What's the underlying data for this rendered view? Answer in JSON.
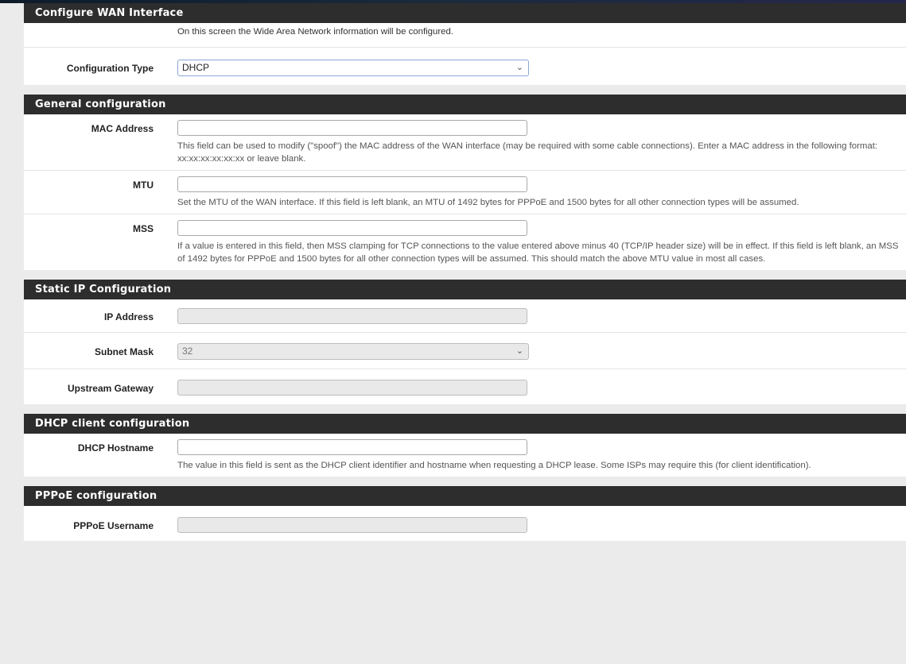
{
  "sections": {
    "wan": {
      "title": "Configure WAN Interface",
      "intro": "On this screen the Wide Area Network information will be configured.",
      "config_type_label": "Configuration Type",
      "config_type_value": "DHCP"
    },
    "general": {
      "title": "General configuration",
      "mac_label": "MAC Address",
      "mac_value": "",
      "mac_help": "This field can be used to modify (\"spoof\") the MAC address of the WAN interface (may be required with some cable connections). Enter a MAC address in the following format: xx:xx:xx:xx:xx:xx or leave blank.",
      "mtu_label": "MTU",
      "mtu_value": "",
      "mtu_help": "Set the MTU of the WAN interface. If this field is left blank, an MTU of 1492 bytes for PPPoE and 1500 bytes for all other connection types will be assumed.",
      "mss_label": "MSS",
      "mss_value": "",
      "mss_help": "If a value is entered in this field, then MSS clamping for TCP connections to the value entered above minus 40 (TCP/IP header size) will be in effect. If this field is left blank, an MSS of 1492 bytes for PPPoE and 1500 bytes for all other connection types will be assumed. This should match the above MTU value in most all cases."
    },
    "static": {
      "title": "Static IP Configuration",
      "ip_label": "IP Address",
      "ip_value": "",
      "subnet_label": "Subnet Mask",
      "subnet_value": "32",
      "gateway_label": "Upstream Gateway",
      "gateway_value": ""
    },
    "dhcp": {
      "title": "DHCP client configuration",
      "hostname_label": "DHCP Hostname",
      "hostname_value": "",
      "hostname_help": "The value in this field is sent as the DHCP client identifier and hostname when requesting a DHCP lease. Some ISPs may require this (for client identification)."
    },
    "pppoe": {
      "title": "PPPoE configuration",
      "username_label": "PPPoE Username",
      "username_value": ""
    }
  },
  "icons": {
    "select_arrow": "chevron-down-icon"
  }
}
